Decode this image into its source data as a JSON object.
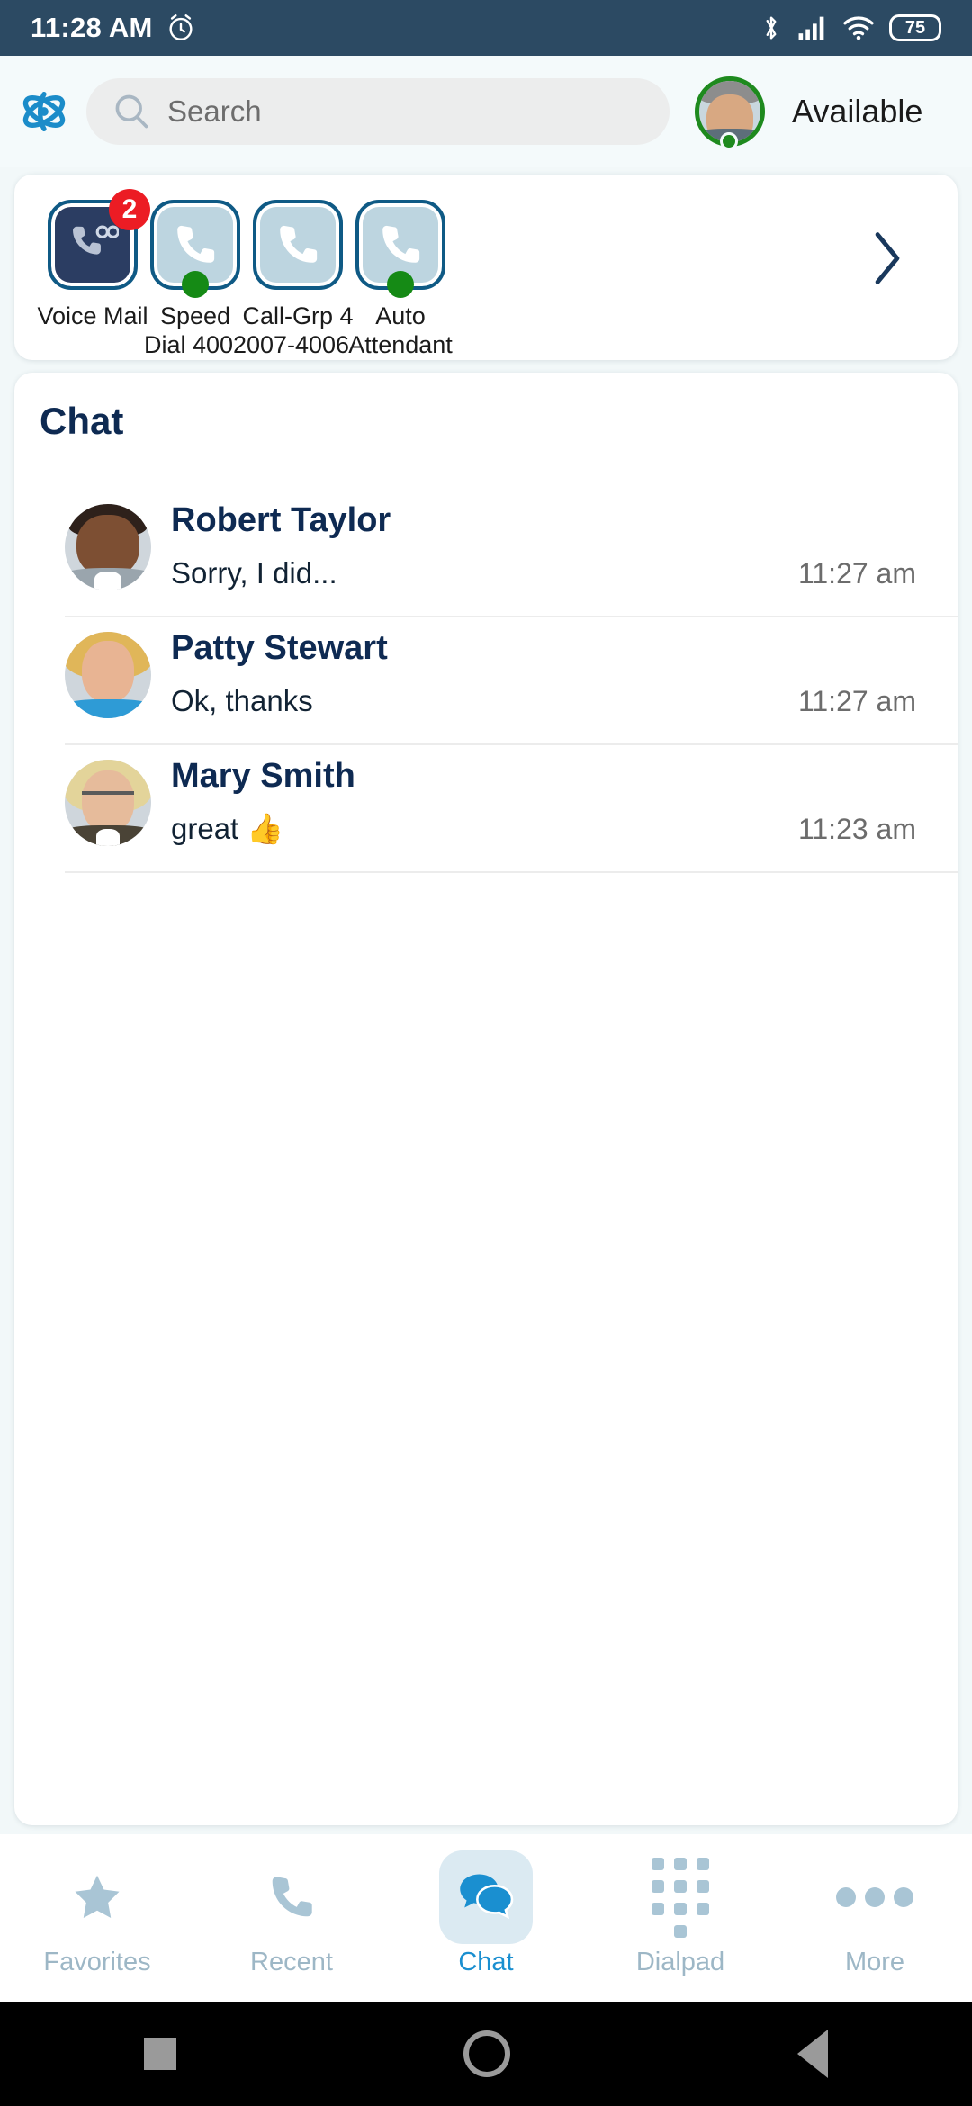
{
  "status_bar": {
    "time": "11:28 AM",
    "alarm_icon": "alarm-clock-icon",
    "bluetooth_icon": "bluetooth-icon",
    "signal_icon": "cellular-signal-icon",
    "wifi_icon": "wifi-icon",
    "battery_level": "75"
  },
  "header": {
    "logo_icon": "app-logo-icon",
    "search": {
      "icon": "search-icon",
      "placeholder": "Search",
      "value": ""
    },
    "presence": {
      "label": "Available",
      "color": "#1e8a1e"
    }
  },
  "quick_tiles": {
    "next_icon": "chevron-right-icon",
    "items": [
      {
        "label": "Voice Mail",
        "icon": "voicemail-icon",
        "badge": "2",
        "badge_color": "#ec1c24",
        "selected": true,
        "presence": false
      },
      {
        "label": "Speed\nDial 4002",
        "label_line1": "Speed",
        "label_line2": "Dial 4002",
        "icon": "phone-icon",
        "badge": "",
        "selected": false,
        "presence": true
      },
      {
        "label": "Call-Grp 4\n007-4006",
        "label_line1": "Call-Grp 4",
        "label_line2": "007-4006",
        "icon": "phone-icon",
        "badge": "",
        "selected": false,
        "presence": false
      },
      {
        "label": "Auto\nAttendant",
        "label_line1": "Auto",
        "label_line2": "Attendant",
        "icon": "phone-icon",
        "badge": "",
        "selected": false,
        "presence": true
      }
    ]
  },
  "chat": {
    "title": "Chat",
    "rows": [
      {
        "name": "Robert Taylor",
        "message": "Sorry, I did...",
        "time": "11:27 am",
        "avatar": "avatar-robert-taylor"
      },
      {
        "name": "Patty Stewart",
        "message": "Ok, thanks",
        "time": "11:27 am",
        "avatar": "avatar-patty-stewart"
      },
      {
        "name": "Mary Smith",
        "message": "great 👍",
        "time": "11:23 am",
        "avatar": "avatar-mary-smith"
      }
    ]
  },
  "tab_bar": {
    "active_color": "#1a8fd0",
    "inactive_color": "#9db7c6",
    "tabs": [
      {
        "label": "Favorites",
        "icon": "star-icon",
        "active": false
      },
      {
        "label": "Recent",
        "icon": "phone-icon",
        "active": false
      },
      {
        "label": "Chat",
        "icon": "chat-bubbles-icon",
        "active": true
      },
      {
        "label": "Dialpad",
        "icon": "dialpad-icon",
        "active": false
      },
      {
        "label": "More",
        "icon": "ellipsis-icon",
        "active": false
      }
    ]
  },
  "android_nav": {
    "recents_icon": "square-recents-icon",
    "home_icon": "circle-home-icon",
    "back_icon": "triangle-back-icon"
  }
}
